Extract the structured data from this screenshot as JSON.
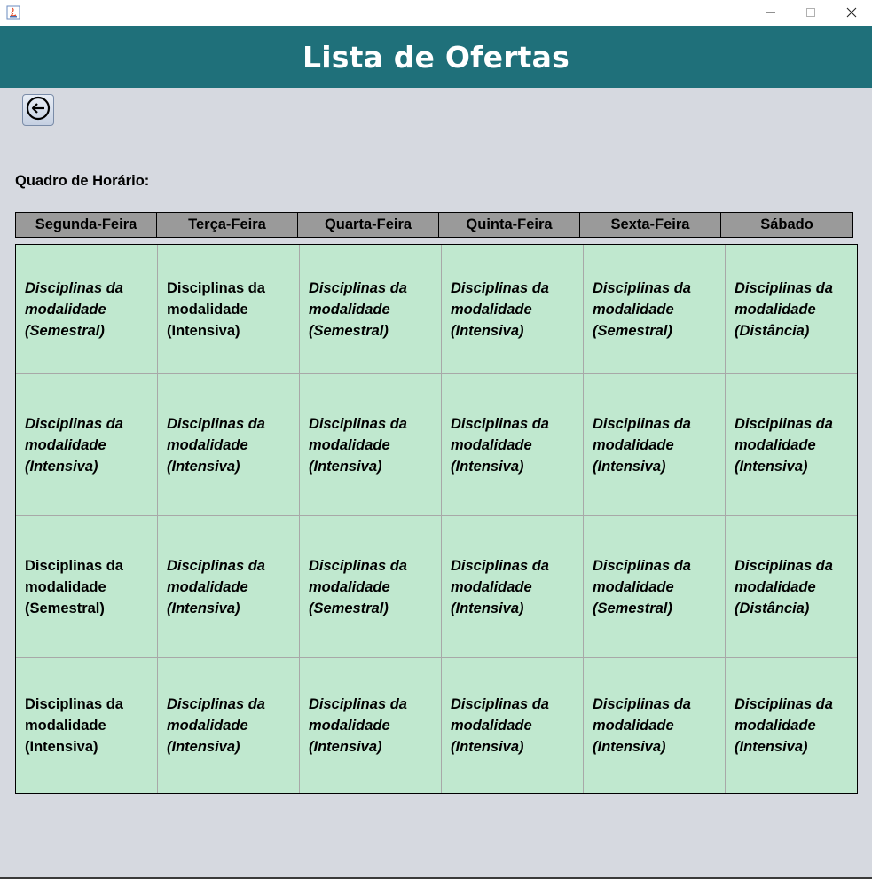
{
  "window": {
    "title": "",
    "icons": {
      "app": "java-icon",
      "minimize": "minimize-icon",
      "maximize": "maximize-icon",
      "close": "close-icon"
    }
  },
  "header": {
    "title": "Lista de Ofertas",
    "color": "#1f707a"
  },
  "back_button": {
    "icon": "arrow-left-circle-icon"
  },
  "schedule": {
    "label": "Quadro de Horário:",
    "days": [
      "Segunda-Feira",
      "Terça-Feira",
      "Quarta-Feira",
      "Quinta-Feira",
      "Sexta-Feira",
      "Sábado"
    ],
    "rows": [
      [
        {
          "text": "Disciplinas da\nmodalidade\n(Semestral)",
          "italic": true
        },
        {
          "text": "Disciplinas da\nmodalidade\n(Intensiva)",
          "italic": false
        },
        {
          "text": "Disciplinas da\nmodalidade\n(Semestral)",
          "italic": true
        },
        {
          "text": "Disciplinas da\nmodalidade\n(Intensiva)",
          "italic": true
        },
        {
          "text": "Disciplinas da\nmodalidade\n(Semestral)",
          "italic": true
        },
        {
          "text": "Disciplinas da\nmodalidade\n(Distância)",
          "italic": true
        }
      ],
      [
        {
          "text": "Disciplinas da\nmodalidade\n(Intensiva)",
          "italic": true
        },
        {
          "text": "Disciplinas da\nmodalidade\n(Intensiva)",
          "italic": true
        },
        {
          "text": "Disciplinas da\nmodalidade\n(Intensiva)",
          "italic": true
        },
        {
          "text": "Disciplinas da\nmodalidade\n(Intensiva)",
          "italic": true
        },
        {
          "text": "Disciplinas da\nmodalidade\n(Intensiva)",
          "italic": true
        },
        {
          "text": "Disciplinas da\nmodalidade\n(Intensiva)",
          "italic": true
        }
      ],
      [
        {
          "text": "Disciplinas da\nmodalidade\n(Semestral)",
          "italic": false
        },
        {
          "text": "Disciplinas da\nmodalidade\n(Intensiva)",
          "italic": true
        },
        {
          "text": "Disciplinas da\nmodalidade\n(Semestral)",
          "italic": true
        },
        {
          "text": "Disciplinas da\nmodalidade\n(Intensiva)",
          "italic": true
        },
        {
          "text": "Disciplinas da\nmodalidade\n(Semestral)",
          "italic": true
        },
        {
          "text": "Disciplinas da\nmodalidade\n(Distância)",
          "italic": true
        }
      ],
      [
        {
          "text": "Disciplinas da\nmodalidade\n(Intensiva)",
          "italic": false
        },
        {
          "text": "Disciplinas da\nmodalidade\n(Intensiva)",
          "italic": true
        },
        {
          "text": "Disciplinas da\nmodalidade\n(Intensiva)",
          "italic": true
        },
        {
          "text": "Disciplinas da\nmodalidade\n(Intensiva)",
          "italic": true
        },
        {
          "text": "Disciplinas da\nmodalidade\n(Intensiva)",
          "italic": true
        },
        {
          "text": "Disciplinas da\nmodalidade\n(Intensiva)",
          "italic": true
        }
      ]
    ]
  }
}
